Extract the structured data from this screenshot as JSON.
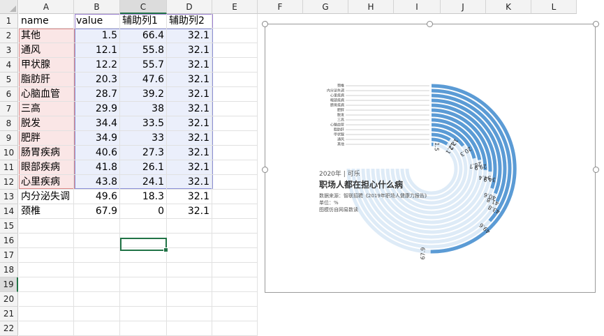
{
  "columns": [
    "A",
    "B",
    "C",
    "D",
    "E",
    "F",
    "G",
    "H",
    "I",
    "J",
    "K",
    "L"
  ],
  "rows": [
    "1",
    "2",
    "3",
    "4",
    "5",
    "6",
    "7",
    "8",
    "9",
    "10",
    "11",
    "12",
    "13",
    "14",
    "15",
    "16",
    "17",
    "18",
    "19",
    "20",
    "21",
    "22"
  ],
  "selected_row": "19",
  "selected_column": "C",
  "header_row": [
    "name",
    "value",
    "辅助列1",
    "辅助列2"
  ],
  "data_rows": [
    [
      "其他",
      "1.5",
      "66.4",
      "32.1"
    ],
    [
      "通风",
      "12.1",
      "55.8",
      "32.1"
    ],
    [
      "甲状腺",
      "12.2",
      "55.7",
      "32.1"
    ],
    [
      "脂肪肝",
      "20.3",
      "47.6",
      "32.1"
    ],
    [
      "心脑血管",
      "28.7",
      "39.2",
      "32.1"
    ],
    [
      "三高",
      "29.9",
      "38",
      "32.1"
    ],
    [
      "脱发",
      "34.4",
      "33.5",
      "32.1"
    ],
    [
      "肥胖",
      "34.9",
      "33",
      "32.1"
    ],
    [
      "肠胃疾病",
      "40.6",
      "27.3",
      "32.1"
    ],
    [
      "眼部疾病",
      "41.8",
      "26.1",
      "32.1"
    ],
    [
      "心里疾病",
      "43.8",
      "24.1",
      "32.1"
    ],
    [
      "内分泌失调",
      "49.6",
      "18.3",
      "32.1"
    ],
    [
      "颈椎",
      "67.9",
      "0",
      "32.1"
    ]
  ],
  "chart_text": {
    "line1": "2020年 | 可乐",
    "title": "职场人都在担心什么病",
    "source": "数据来源：智联招聘《2019年职场人健康力报告》",
    "unit": "单位：%",
    "credit": "图模仿自网易数读"
  },
  "colors": {
    "value_arc": "#5b9bd5",
    "helper_arc": "#deebf7",
    "selection": "#217346"
  },
  "chart_data": {
    "type": "radial-bar",
    "title": "职场人都在担心什么病",
    "categories": [
      "其他",
      "通风",
      "甲状腺",
      "脂肪肝",
      "心脑血管",
      "三高",
      "脱发",
      "肥胖",
      "肠胃疾病",
      "眼部疾病",
      "心里疾病",
      "内分泌失调",
      "颈椎"
    ],
    "series": [
      {
        "name": "value",
        "values": [
          1.5,
          12.1,
          12.2,
          20.3,
          28.7,
          29.9,
          34.4,
          34.9,
          40.6,
          41.8,
          43.8,
          49.6,
          67.9
        ]
      },
      {
        "name": "辅助列1",
        "values": [
          66.4,
          55.8,
          55.7,
          47.6,
          39.2,
          38,
          33.5,
          33,
          27.3,
          26.1,
          24.1,
          18.3,
          0
        ]
      },
      {
        "name": "辅助列2",
        "values": [
          32.1,
          32.1,
          32.1,
          32.1,
          32.1,
          32.1,
          32.1,
          32.1,
          32.1,
          32.1,
          32.1,
          32.1,
          32.1
        ]
      }
    ],
    "data_labels": [
      "1.5",
      "12.1",
      "12.2",
      "20.3",
      "28.7",
      "29.9",
      "34.4",
      "34.9",
      "40.6",
      "41.8",
      "43.8",
      "49.6",
      "67.9"
    ]
  }
}
